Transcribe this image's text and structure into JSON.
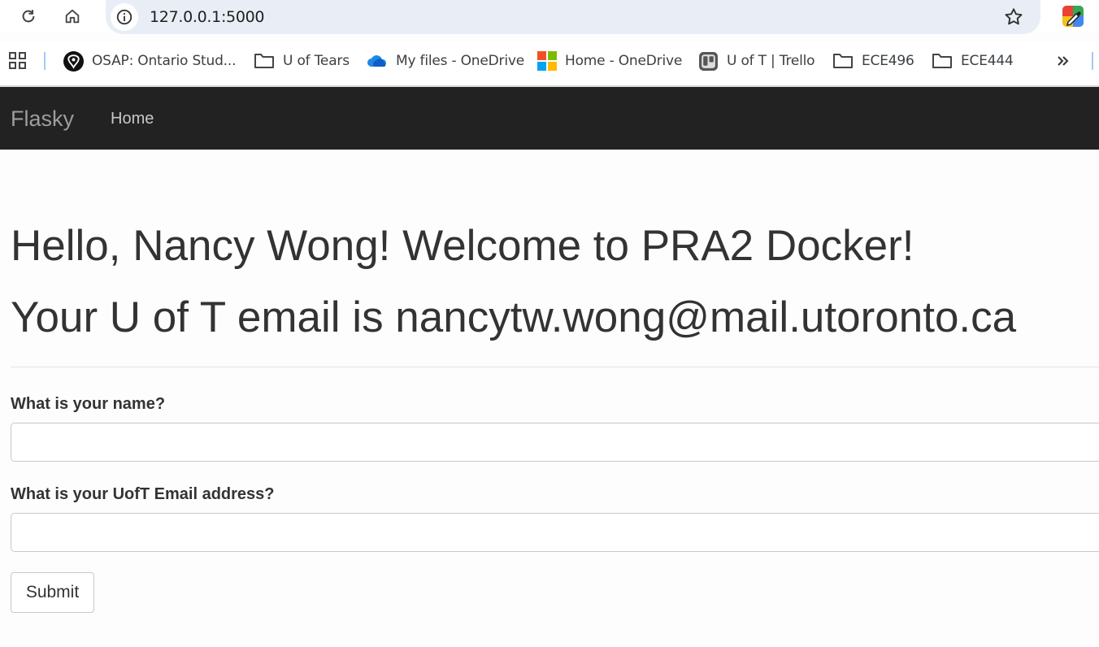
{
  "browser": {
    "url": "127.0.0.1:5000",
    "bookmarks": [
      {
        "label": "OSAP: Ontario Stud...",
        "icon": "osap-icon"
      },
      {
        "label": "U of Tears",
        "icon": "folder-icon"
      },
      {
        "label": "My files - OneDrive",
        "icon": "onedrive-icon"
      },
      {
        "label": "Home - OneDrive",
        "icon": "microsoft-icon"
      },
      {
        "label": "U of T | Trello",
        "icon": "trello-icon"
      },
      {
        "label": "ECE496",
        "icon": "folder-icon"
      },
      {
        "label": "ECE444",
        "icon": "folder-icon"
      }
    ],
    "more_icon": "chevron-double-right-icon"
  },
  "navbar": {
    "brand": "Flasky",
    "home": "Home"
  },
  "main": {
    "greeting": "Hello, Nancy Wong! Welcome to PRA2 Docker!",
    "email_line": "Your U of T email is nancytw.wong@mail.utoronto.ca",
    "form": {
      "name_label": "What is your name?",
      "name_value": "",
      "email_label": "What is your UofT Email address?",
      "email_value": "",
      "submit": "Submit"
    }
  },
  "colors": {
    "navbar_bg": "#222222",
    "text": "#333333",
    "omnibox_bg": "#e9eef6"
  }
}
